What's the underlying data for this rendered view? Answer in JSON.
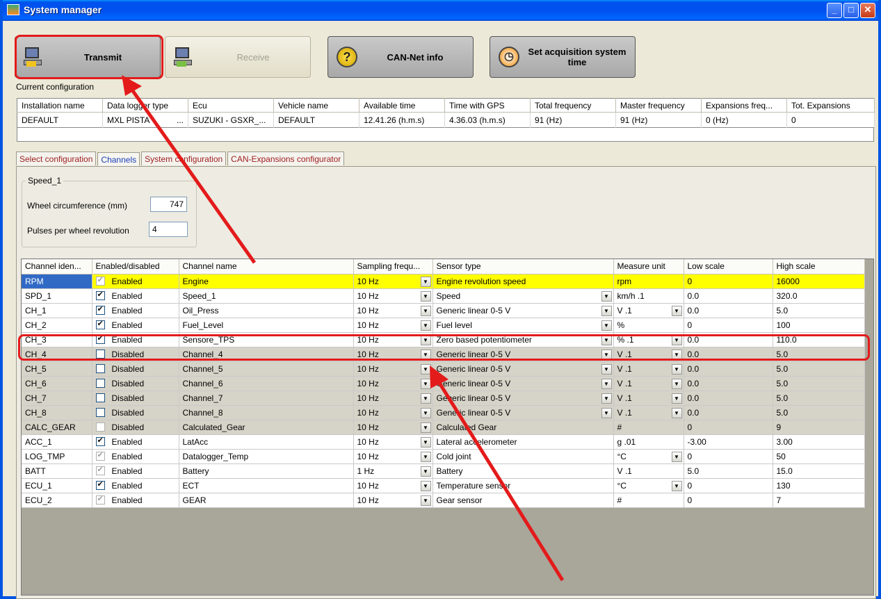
{
  "window": {
    "title": "System manager",
    "controls": [
      "_",
      "□",
      "✕"
    ]
  },
  "toolbar": {
    "transmit": "Transmit",
    "receive": "Receive",
    "can_info": "CAN-Net info",
    "set_time": "Set acquisition system time"
  },
  "config": {
    "label": "Current configuration",
    "headers": [
      "Installation name",
      "Data logger type",
      "Ecu",
      "Vehicle name",
      "Available time",
      "Time with GPS",
      "Total frequency",
      "Master frequency",
      "Expansions freq...",
      "Tot. Expansions"
    ],
    "row": [
      "DEFAULT",
      "MXL PISTA",
      "SUZUKI - GSXR_...",
      "DEFAULT",
      "12.41.26 (h.m.s)",
      "4.36.03 (h.m.s)",
      "91 (Hz)",
      "91 (Hz)",
      "0 (Hz)",
      "0"
    ],
    "ellipsis": "..."
  },
  "tabs": [
    "Select configuration",
    "Channels",
    "System configuration",
    "CAN-Expansions configurator"
  ],
  "speed_group": {
    "title": "Speed_1",
    "wheel_label": "Wheel circumference  (mm)",
    "wheel_value": "747",
    "pulses_label": "Pulses per wheel revolution",
    "pulses_value": "4"
  },
  "channels": {
    "headers": [
      "Channel iden...",
      "Enabled/disabled",
      "Channel name",
      "Sampling frequ...",
      "Sensor type",
      "Measure unit",
      "Low scale",
      "High scale"
    ],
    "rows": [
      {
        "id": "RPM",
        "enabled": true,
        "state": "Enabled",
        "name": "Engine",
        "freq": "10 Hz",
        "sensor": "Engine revolution speed",
        "unit": "rpm",
        "low": "0",
        "high": "16000",
        "style": "hl",
        "gray": true,
        "sdd": false,
        "udd": false
      },
      {
        "id": "SPD_1",
        "enabled": true,
        "state": "Enabled",
        "name": "Speed_1",
        "freq": "10 Hz",
        "sensor": "Speed",
        "unit": "km/h .1",
        "low": "0.0",
        "high": "320.0",
        "style": "",
        "gray": false,
        "sdd": true,
        "udd": false
      },
      {
        "id": "CH_1",
        "enabled": true,
        "state": "Enabled",
        "name": "Oil_Press",
        "freq": "10 Hz",
        "sensor": "Generic linear 0-5 V",
        "unit": "V .1",
        "low": "0.0",
        "high": "5.0",
        "style": "",
        "gray": false,
        "sdd": true,
        "udd": true
      },
      {
        "id": "CH_2",
        "enabled": true,
        "state": "Enabled",
        "name": "Fuel_Level",
        "freq": "10 Hz",
        "sensor": "Fuel level",
        "unit": "%",
        "low": "0",
        "high": "100",
        "style": "",
        "gray": false,
        "sdd": true,
        "udd": false
      },
      {
        "id": "CH_3",
        "enabled": true,
        "state": "Enabled",
        "name": "Sensore_TPS",
        "freq": "10 Hz",
        "sensor": "Zero based potentiometer",
        "unit": "% .1",
        "low": "0.0",
        "high": "110.0",
        "style": "",
        "gray": false,
        "sdd": true,
        "udd": true
      },
      {
        "id": "CH_4",
        "enabled": false,
        "state": "Disabled",
        "name": "Channel_4",
        "freq": "10 Hz",
        "sensor": "Generic linear 0-5 V",
        "unit": "V .1",
        "low": "0.0",
        "high": "5.0",
        "style": "dis",
        "gray": false,
        "sdd": true,
        "udd": true
      },
      {
        "id": "CH_5",
        "enabled": false,
        "state": "Disabled",
        "name": "Channel_5",
        "freq": "10 Hz",
        "sensor": "Generic linear 0-5 V",
        "unit": "V .1",
        "low": "0.0",
        "high": "5.0",
        "style": "dis",
        "gray": false,
        "sdd": true,
        "udd": true
      },
      {
        "id": "CH_6",
        "enabled": false,
        "state": "Disabled",
        "name": "Channel_6",
        "freq": "10 Hz",
        "sensor": "Generic linear 0-5 V",
        "unit": "V .1",
        "low": "0.0",
        "high": "5.0",
        "style": "dis",
        "gray": false,
        "sdd": true,
        "udd": true
      },
      {
        "id": "CH_7",
        "enabled": false,
        "state": "Disabled",
        "name": "Channel_7",
        "freq": "10 Hz",
        "sensor": "Generic linear 0-5 V",
        "unit": "V .1",
        "low": "0.0",
        "high": "5.0",
        "style": "dis",
        "gray": false,
        "sdd": true,
        "udd": true
      },
      {
        "id": "CH_8",
        "enabled": false,
        "state": "Disabled",
        "name": "Channel_8",
        "freq": "10 Hz",
        "sensor": "Generic linear 0-5 V",
        "unit": "V .1",
        "low": "0.0",
        "high": "5.0",
        "style": "dis",
        "gray": false,
        "sdd": true,
        "udd": true
      },
      {
        "id": "CALC_GEAR",
        "enabled": false,
        "state": "Disabled",
        "name": "Calculated_Gear",
        "freq": "10 Hz",
        "sensor": "Calculated Gear",
        "unit": "#",
        "low": "0",
        "high": "9",
        "style": "dis",
        "gray": true,
        "sdd": false,
        "udd": false
      },
      {
        "id": "ACC_1",
        "enabled": true,
        "state": "Enabled",
        "name": "LatAcc",
        "freq": "10 Hz",
        "sensor": "Lateral accelerometer",
        "unit": "g .01",
        "low": "-3.00",
        "high": "3.00",
        "style": "",
        "gray": false,
        "sdd": false,
        "udd": false
      },
      {
        "id": "LOG_TMP",
        "enabled": true,
        "state": "Enabled",
        "name": "Datalogger_Temp",
        "freq": "10 Hz",
        "sensor": "Cold joint",
        "unit": "°C",
        "low": "0",
        "high": "50",
        "style": "",
        "gray": true,
        "sdd": false,
        "udd": true
      },
      {
        "id": "BATT",
        "enabled": true,
        "state": "Enabled",
        "name": "Battery",
        "freq": "1 Hz",
        "sensor": "Battery",
        "unit": "V .1",
        "low": "5.0",
        "high": "15.0",
        "style": "",
        "gray": true,
        "sdd": false,
        "udd": false
      },
      {
        "id": "ECU_1",
        "enabled": true,
        "state": "Enabled",
        "name": "ECT",
        "freq": "10 Hz",
        "sensor": "Temperature sensor",
        "unit": "°C",
        "low": "0",
        "high": "130",
        "style": "",
        "gray": false,
        "sdd": false,
        "udd": true
      },
      {
        "id": "ECU_2",
        "enabled": true,
        "state": "Enabled",
        "name": "GEAR",
        "freq": "10 Hz",
        "sensor": "Gear sensor",
        "unit": "#",
        "low": "0",
        "high": "7",
        "style": "",
        "gray": true,
        "sdd": false,
        "udd": false
      }
    ]
  },
  "colors": {
    "annotation": "#e31b1b",
    "highlight_row": "#ffff00",
    "selected_cell": "#316ac5"
  }
}
